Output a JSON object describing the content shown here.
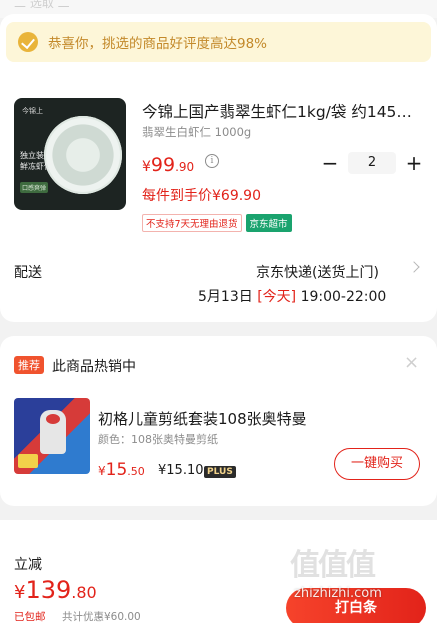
{
  "top": {
    "ghost_text": "二 选取 二"
  },
  "banner": {
    "text": "恭喜你，挑选的商品好评度高达98%"
  },
  "product": {
    "image_brand": "今锦上",
    "image_tag": "独立装 鲜冻虾仁",
    "image_badge": "口感爽弹",
    "title": "今锦上国产翡翠生虾仁1kg/袋 约145…",
    "spec": "翡翠生白虾仁 1000g",
    "price": {
      "currency": "¥",
      "integer": "99",
      "decimal": ".90"
    },
    "info_glyph": "i",
    "quantity": "2",
    "minus_glyph": "−",
    "plus_glyph": "+",
    "per_price": "每件到手价¥69.90",
    "badge_no_return": "不支持7天无理由退货",
    "badge_store": "京东超市"
  },
  "shipping": {
    "label": "配送",
    "method": "京东快递(送货上门)",
    "date": "5月13日",
    "today": "[今天]",
    "time": "19:00-22:00"
  },
  "recommend": {
    "tag": "推荐",
    "title": "此商品热销中",
    "close": "×",
    "name": "初格儿童剪纸套装108张奥特曼",
    "color": "颜色：108张奥特曼剪纸",
    "price": {
      "currency": "¥",
      "integer": "15",
      "decimal": ".50"
    },
    "plus_price": "¥15.10",
    "plus_badge": "PLUS",
    "buy_label": "一键购买"
  },
  "checkout": {
    "sub_label": "立减",
    "total": {
      "currency": "¥",
      "integer": "139",
      "decimal": ".80"
    },
    "free_shipping": "已包邮",
    "discount": "共计优惠¥60.00",
    "button": "打白条"
  },
  "watermark": {
    "glyphs": "值值值",
    "url": "zhizhizhi.com"
  },
  "colors": {
    "accent": "#e2231a",
    "banner_bg": "#fdf6d8",
    "banner_text": "#c3892a",
    "store_badge": "#1aa36e"
  }
}
